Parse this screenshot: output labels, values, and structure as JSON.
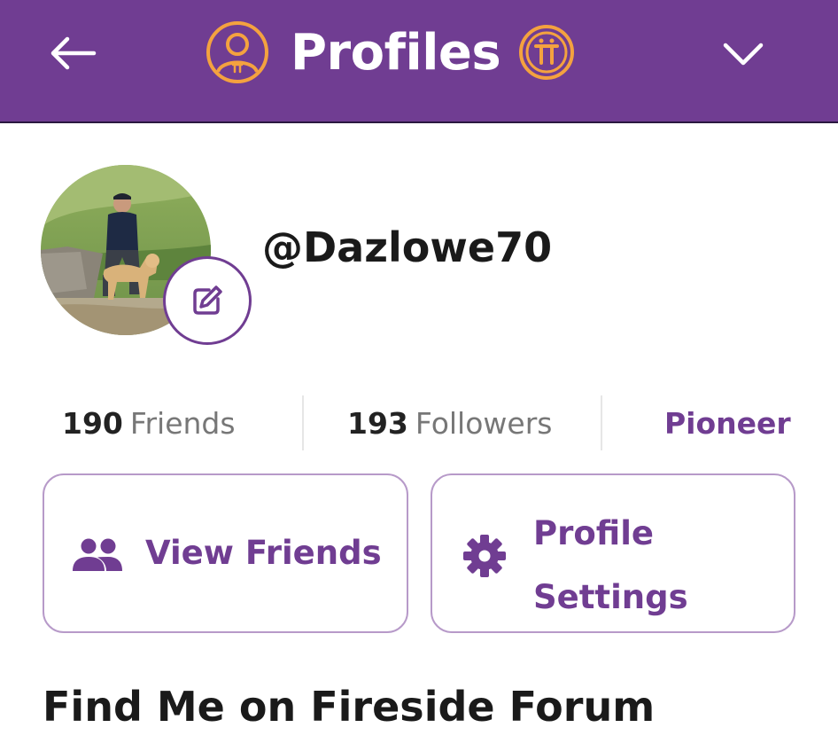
{
  "header": {
    "back_icon": "arrow-left-icon",
    "profile_icon": "profile-badge-icon",
    "title": "Profiles",
    "pi_icon": "pi-coin-icon",
    "dropdown_icon": "chevron-down-icon",
    "background_color": "#703d92",
    "accent_color": "#f4a23f"
  },
  "profile": {
    "username": "@Dazlowe70",
    "edit_icon": "edit-pencil-icon",
    "stats": {
      "friends_count": "190",
      "friends_label": "Friends",
      "followers_count": "193",
      "followers_label": "Followers",
      "role": "Pioneer"
    }
  },
  "actions": {
    "view_friends_label": "View Friends",
    "view_friends_icon": "people-icon",
    "profile_settings_label": "Profile Settings",
    "profile_settings_icon": "gear-icon"
  },
  "sections": {
    "forum_title": "Find Me on Fireside Forum"
  }
}
